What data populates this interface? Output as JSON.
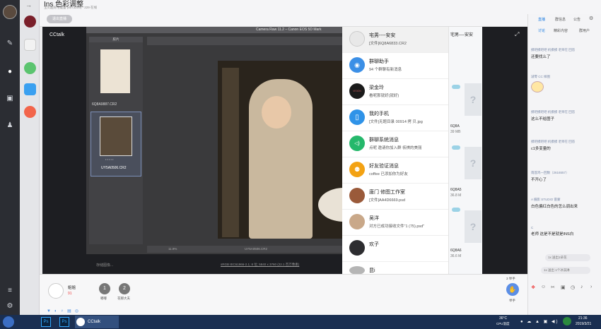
{
  "header": {
    "title": "Ins 色彩调整",
    "subtitle": "宝贝超好用能量 (8572209) · 229 在线",
    "exit_button": "退出直播"
  },
  "video": {
    "room_label": "CCtalk",
    "ps_title": "Camera Raw 11.2 – Canon EOS 5D Mark",
    "filmstrip_header": "胶片",
    "thumbs": [
      {
        "name": "6Q8A9887.CR2"
      },
      {
        "name": "UY5A0506.CR2",
        "stars": "• • • • •"
      }
    ],
    "zoom": "11.9%",
    "filename": "UY5A0506.CR2",
    "save_label": "存储图像...",
    "info_line": "sRGB IEC61966-2.1; 8 位; 5840 x 3760 (22.1 百万像素)"
  },
  "conversations": {
    "header": "宅男----安安",
    "items": [
      {
        "name": "宅男----安安",
        "preview": "[文件]6Q8A6833.CR2",
        "avatar": "#e8e8e8",
        "avatar_text": ""
      },
      {
        "name": "群聊助手",
        "preview": "94 个群聊有新消息",
        "avatar": "#3b8fe6",
        "avatar_text": "◉"
      },
      {
        "name": "梁金玲",
        "preview": "看呢那就好(就好)",
        "avatar": "#1b1b1b",
        "avatar_text": "VISION"
      },
      {
        "name": "我的手机",
        "preview": "[文件]无题目录 00914 拷 贝.jpg",
        "avatar": "#2f93e8",
        "avatar_text": "▯"
      },
      {
        "name": "群聊系统消息",
        "preview": "点呢 邀请你加入群 祆祺的美丽",
        "avatar": "#25b86b",
        "avatar_text": "◁)"
      },
      {
        "name": "好友验证消息",
        "preview": "coffee 已添加你为好友",
        "avatar": "#f3a213",
        "avatar_text": "⚉"
      },
      {
        "name": "唐门 修图工作室",
        "preview": "[文件]AA4D6669.psd",
        "avatar": "#9a5a3a",
        "avatar_text": ""
      },
      {
        "name": "吴洋",
        "preview": "对方已成功接收文件\"1 (75).psd\"",
        "avatar": "#c9a889",
        "avatar_text": ""
      },
      {
        "name": "欢子",
        "preview": "",
        "avatar": "#2d2d30",
        "avatar_text": ""
      },
      {
        "name": "昆i",
        "preview": "",
        "avatar": "#b5b5b5",
        "avatar_text": ""
      }
    ]
  },
  "chat_window": {
    "title": "宅男----安安",
    "files": [
      {
        "name": "6Q8A",
        "size": "39 MB"
      },
      {
        "name": "6Q8A5",
        "size": "36.8 M"
      },
      {
        "name": "6Q8A6",
        "size": "36.6 M"
      }
    ]
  },
  "right_panel": {
    "tabs": [
      "直播",
      "群信息",
      "公告"
    ],
    "subtabs": [
      "讨论",
      "精彩内容",
      "群用户"
    ],
    "messages": [
      {
        "meta": "摸吧摸吧吧 机摸摸 老师在 回答",
        "text": "还要找么了"
      },
      {
        "meta": "减零 CC 样图",
        "text": "",
        "sticker": true
      },
      {
        "meta": "摸吧摸吧吧 机摸摸 老师在 回答",
        "text": "这么不给图子"
      },
      {
        "meta": "摸吧摸吧吧 机摸摸 老师在 回答",
        "text": "c1多变量的"
      },
      {
        "meta": "雨莲鸡一回数（2616557）",
        "text": "不开心了"
      },
      {
        "meta": "A 摄影 STUDIO 雷蒙",
        "text": "白色偏红白色的怎么调出来"
      },
      {
        "meta": "C",
        "text": "老师 这是不是就是INS白"
      }
    ],
    "gift_rows": [
      "1x 送出1朵花",
      "1x 送出 1个冰淇淋"
    ],
    "toolbar_icons": [
      "gift-icon",
      "emoji-icon",
      "scissors-icon",
      "image-icon",
      "clock-icon",
      "bell-icon",
      "arrow-right-icon"
    ]
  },
  "bottom": {
    "host_name": "姐姐",
    "host_fans": "91",
    "users": [
      {
        "name": "嘟嘟"
      },
      {
        "name": "花那大夫"
      }
    ],
    "raise_count": "3 举手",
    "raise_label": "举手"
  },
  "taskbar": {
    "apps": [
      {
        "label": "Ps"
      },
      {
        "label": "Ps"
      },
      {
        "label": "CCtalk"
      }
    ],
    "weather": "36°C",
    "weather_sub": "CPU温度",
    "time": "21:36",
    "date": "2019/3/21"
  }
}
